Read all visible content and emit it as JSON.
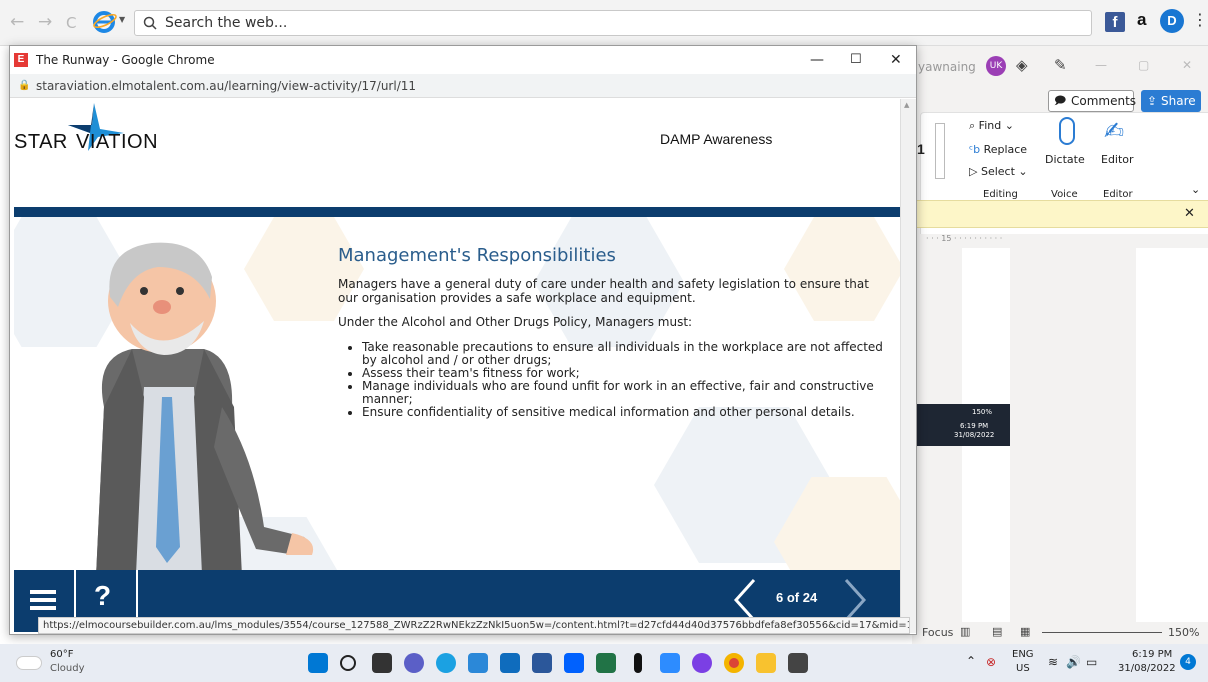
{
  "browser": {
    "search_placeholder": "Search the web...",
    "back": "←",
    "forward": "→",
    "refresh": "C"
  },
  "word": {
    "user_name": "yawnaing",
    "avatar_initials": "UK",
    "comments": "Comments",
    "share": "Share",
    "find": "Find",
    "replace": "Replace",
    "select": "Select",
    "dictate": "Dictate",
    "editor": "Editor",
    "group_editing": "Editing",
    "group_voice": "Voice",
    "group_editor": "Editor",
    "font_size": "1",
    "ruler_mark": "15",
    "focus": "Focus",
    "zoom": "150%",
    "mini_zoom": "150%",
    "mini_time": "6:19 PM",
    "mini_date": "31/08/2022"
  },
  "popup": {
    "window_title": "The Runway - Google Chrome",
    "url": "staraviation.elmotalent.com.au/learning/view-activity/17/url/11",
    "status_url": "https://elmocoursebuilder.com.au/lms_modules/3554/course_127588_ZWRzZ2RwNEkzZzNkI5uon5w=/content.html?t=d27cfd44d40d37576bbdfefa8ef30556&cid=17&mid=11&uid=56..."
  },
  "course": {
    "logo_text_left": "STAR",
    "logo_text_right": "VIATION",
    "module_title": "DAMP Awareness",
    "heading": "Management's Responsibilities",
    "intro": "Managers have a general duty of care under health and safety legislation to ensure that our organisation provides a safe workplace and equipment.",
    "policy_line": "Under the Alcohol and Other Drugs Policy, Managers must:",
    "bullets": [
      "Take reasonable precautions to ensure all individuals in the workplace are not affected by alcohol and / or other drugs;",
      "Assess their team's fitness for work;",
      "Manage individuals who are found unfit for work in an effective, fair and constructive manner;",
      "Ensure confidentiality of sensitive medical information and other personal details."
    ],
    "help": "?",
    "page_indicator": "6 of 24"
  },
  "taskbar": {
    "temp": "60°F",
    "weather": "Cloudy",
    "lang": "ENG",
    "region": "US",
    "time": "6:19 PM",
    "date": "31/08/2022",
    "notif_count": "4"
  },
  "colors": {
    "navy": "#0c3d6e",
    "heading_blue": "#2a5d8c",
    "accent_blue": "#2b7cd3"
  }
}
